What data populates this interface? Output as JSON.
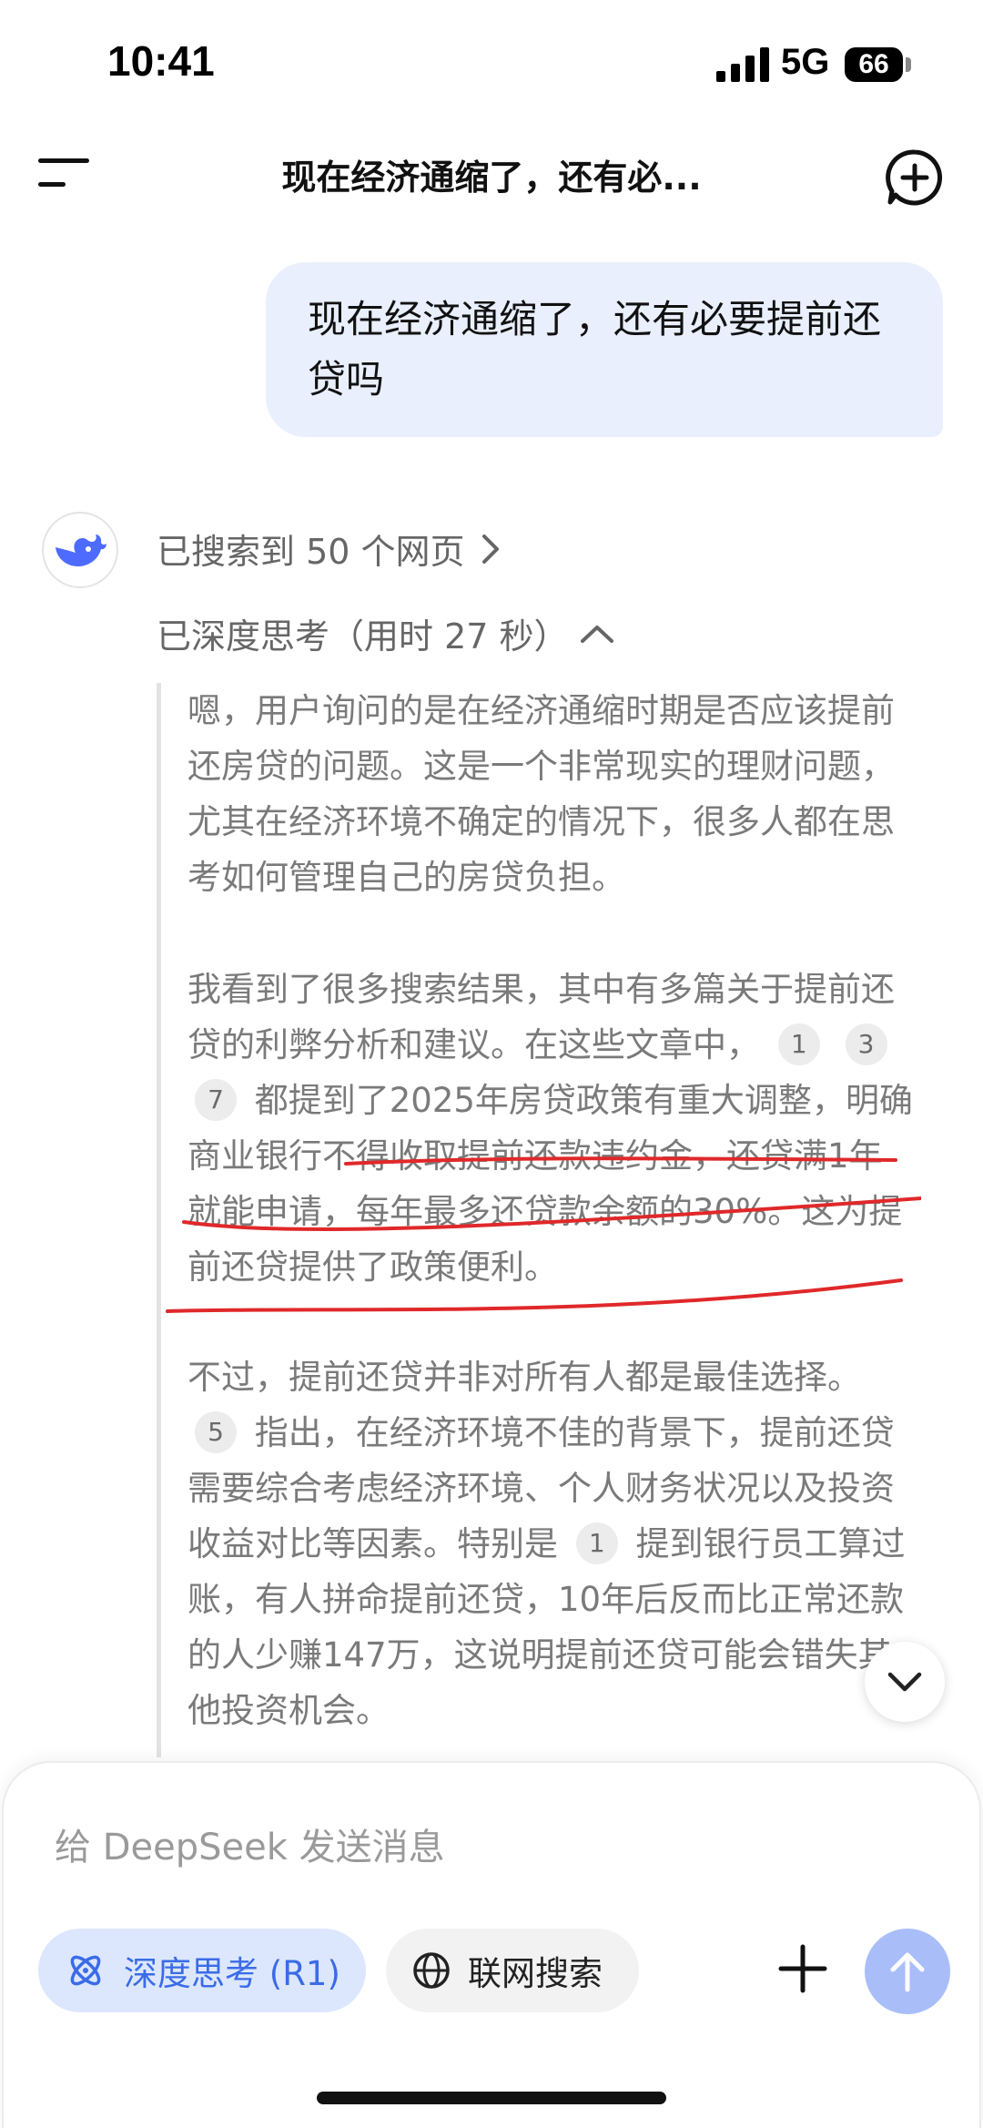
{
  "status_bar": {
    "time": "10:41",
    "network": "5G",
    "battery": "66"
  },
  "header": {
    "title": "现在经济通缩了，还有必..."
  },
  "user_message": {
    "text": "现在经济通缩了，还有必要提前还贷吗"
  },
  "assistant": {
    "search_summary": "已搜索到 50 个网页",
    "think_summary": "已深度思考（用时 27 秒）",
    "paragraph_1": "嗯，用户询问的是在经济通缩时期是否应该提前还房贷的问题。这是一个非常现实的理财问题，尤其在经济环境不确定的情况下，很多人都在思考如何管理自己的房贷负担。",
    "paragraph_2": {
      "intro": "我看到了很多搜索结果，其中有多篇关于提前还贷的利弊分析和建议。在这些文章中，",
      "citations": [
        "1",
        "3",
        "7"
      ],
      "body_a": "都提到了2025年房贷政策有重大调整，",
      "body_b": "明确商业银行不得收取提前还款违约金，还贷满1年就能申请，每年最多还贷款余额的30%。这为提前还贷提供了政策便利。"
    },
    "paragraph_3": {
      "a": "不过，提前还贷并非对所有人都是最佳选择。",
      "cite_1": "5",
      "b": "指出，在经济环境不佳的背景下，提前还贷需要综合考虑经济环境、个人财务状况以及投资收益对比等因素。特别是",
      "cite_2": "1",
      "c": "提到银行员工算过账，有人拼命提前还贷，10年后反而比正常还款的人少赚147万，这说明提前还贷可能会错失其他投资机会。"
    }
  },
  "composer": {
    "placeholder": "给 DeepSeek 发送消息",
    "deep_think_label": "深度思考 (R1)",
    "web_search_label": "联网搜索"
  },
  "colors": {
    "accent": "#3b6be6",
    "annotation_red": "#e0282a",
    "user_bubble": "#e9effd",
    "send_button": "#a9bef9"
  }
}
